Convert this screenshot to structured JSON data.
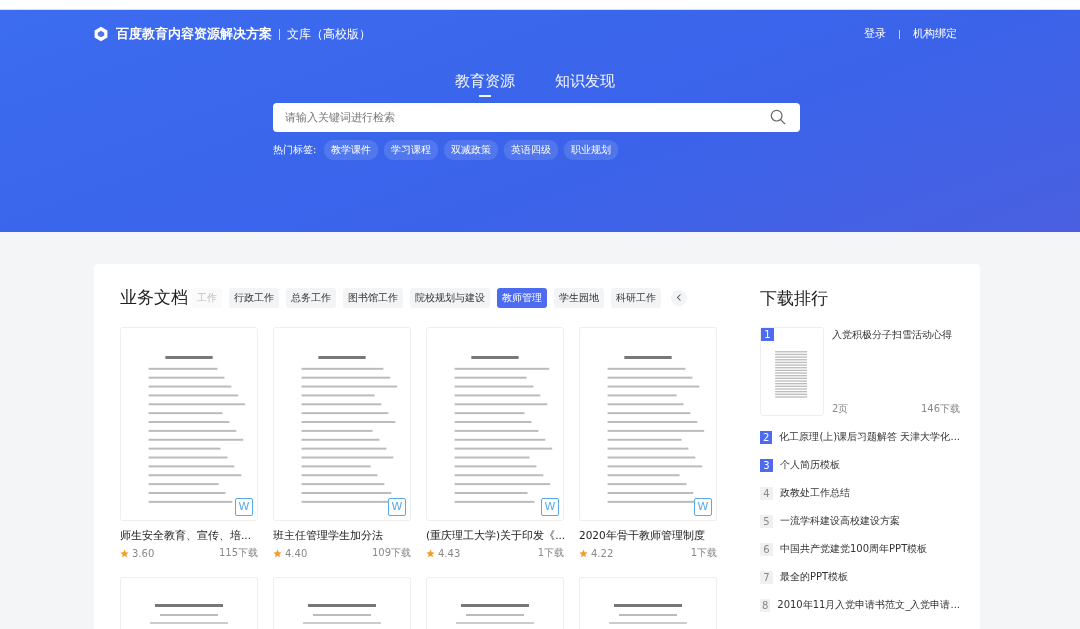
{
  "header": {
    "brand": "百度教育内容资源解决方案",
    "product": "文库（高校版）",
    "links": [
      {
        "label": "登录"
      },
      {
        "label": "机构绑定"
      }
    ]
  },
  "hero": {
    "tabs": [
      {
        "label": "教育资源",
        "selected": true
      },
      {
        "label": "知识发现",
        "selected": false
      }
    ],
    "search": {
      "placeholder": "请输入关键词进行检索"
    },
    "hot_tags": {
      "label": "热门标签:",
      "tags": [
        "教学课件",
        "学习课程",
        "双减政策",
        "英语四级",
        "职业规划"
      ]
    }
  },
  "documents": {
    "title": "业务文档",
    "categories": [
      {
        "label": "工作",
        "selected": false,
        "faded": true
      },
      {
        "label": "行政工作",
        "selected": false,
        "faded": false
      },
      {
        "label": "总务工作",
        "selected": false,
        "faded": false
      },
      {
        "label": "图书馆工作",
        "selected": false,
        "faded": false
      },
      {
        "label": "院校规划与建设",
        "selected": false,
        "faded": false
      },
      {
        "label": "教师管理",
        "selected": true,
        "faded": false
      },
      {
        "label": "学生园地",
        "selected": false,
        "faded": false
      },
      {
        "label": "科研工作",
        "selected": false,
        "faded": false
      }
    ],
    "cards": [
      {
        "title": "师生安全教育、宣传、培...",
        "rating": "3.60",
        "downloads": "115下载",
        "file_type": "W"
      },
      {
        "title": "班主任管理学生加分法",
        "rating": "4.40",
        "downloads": "109下载",
        "file_type": "W"
      },
      {
        "title": "(重庆理工大学)关于印发《...",
        "rating": "4.43",
        "downloads": "1下载",
        "file_type": "W"
      },
      {
        "title": "2020年骨干教师管理制度",
        "rating": "4.22",
        "downloads": "1下载",
        "file_type": "W"
      }
    ]
  },
  "ranking": {
    "title": "下载排行",
    "first": {
      "rank": "1",
      "title": "入党积极分子扫雪活动心得",
      "pages": "2页",
      "downloads": "146下载",
      "highlighted": true
    },
    "items": [
      {
        "rank": "2",
        "title": "化工原理(上)课后习题解答 天津大学化...",
        "highlighted": true
      },
      {
        "rank": "3",
        "title": "个人简历模板",
        "highlighted": true
      },
      {
        "rank": "4",
        "title": "政教处工作总结",
        "highlighted": false
      },
      {
        "rank": "5",
        "title": "一流学科建设高校建设方案",
        "highlighted": false
      },
      {
        "rank": "6",
        "title": "中国共产党建党100周年PPT模板",
        "highlighted": false
      },
      {
        "rank": "7",
        "title": "最全的PPT模板",
        "highlighted": false
      },
      {
        "rank": "8",
        "title": "2010年11月入党申请书范文_入党申请...",
        "highlighted": false
      }
    ]
  }
}
